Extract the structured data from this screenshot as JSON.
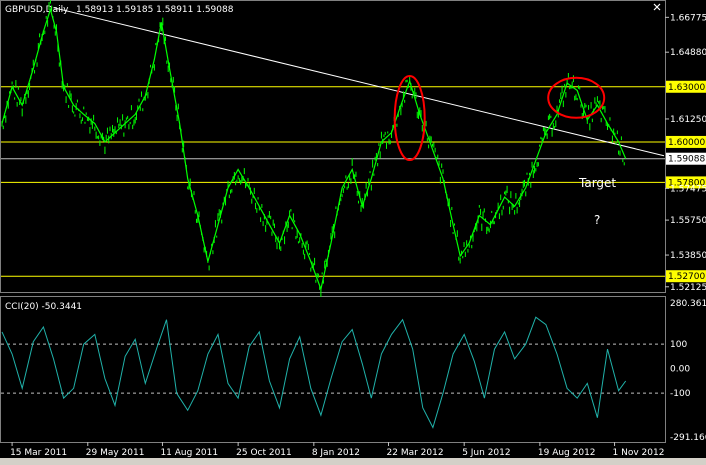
{
  "window": {
    "title": "GBPUSD,Daily",
    "ohlc": "1.58913 1.59185 1.58911 1.59088",
    "close_icon": "x-icon"
  },
  "colors": {
    "background": "#000000",
    "price": "#00ff00",
    "cci": "#20b2aa",
    "level": "#ffff00",
    "trend": "#ffffff",
    "highlight": "#ff0000",
    "current": "#ffffff"
  },
  "chart_data": [
    {
      "type": "line",
      "title": "GBPUSD,Daily",
      "ohlc_text": "1.58913 1.59185 1.58911 1.59088",
      "ylim": [
        1.5195,
        1.675
      ],
      "y_ticks": [
        "1.66775",
        "1.64880",
        "1.61250",
        "1.57475",
        "1.55750",
        "1.53850",
        "1.52125"
      ],
      "x_ticks": [
        "15 Mar 2011",
        "29 May 2011",
        "11 Aug 2011",
        "25 Oct 2011",
        "8 Jan 2012",
        "22 Mar 2012",
        "5 Jun 2012",
        "19 Aug 2012",
        "1 Nov 2012"
      ],
      "levels": [
        {
          "label": "1.63000",
          "value": 1.63
        },
        {
          "label": "1.60000",
          "value": 1.6
        },
        {
          "label": "1.59088",
          "value": 1.59088,
          "current": true
        },
        {
          "label": "1.57800",
          "value": 1.578
        },
        {
          "label": "1.52700",
          "value": 1.527
        }
      ],
      "trendline": {
        "from": {
          "x": "2011-04-25",
          "y": 1.673
        },
        "to": {
          "x": "2012-12-20",
          "y": 1.5925
        }
      },
      "annotations": [
        {
          "text": "Target"
        },
        {
          "text": "?"
        }
      ],
      "highlights": [
        {
          "x": "2012-04-12",
          "y": 1.613
        },
        {
          "x": "2012-09-24",
          "y": 1.624
        }
      ],
      "series": [
        {
          "x": [
            "2011-03-05",
            "2011-03-15",
            "2011-03-25",
            "2011-04-05",
            "2011-04-15",
            "2011-04-22",
            "2011-04-28",
            "2011-05-05",
            "2011-05-15",
            "2011-05-25",
            "2011-06-05",
            "2011-06-15",
            "2011-06-25",
            "2011-07-05",
            "2011-07-15",
            "2011-07-25",
            "2011-08-03",
            "2011-08-10",
            "2011-08-18",
            "2011-08-28",
            "2011-09-05",
            "2011-09-15",
            "2011-09-25",
            "2011-10-05",
            "2011-10-15",
            "2011-10-25",
            "2011-11-05",
            "2011-11-15",
            "2011-11-25",
            "2011-12-05",
            "2011-12-15",
            "2011-12-25",
            "2012-01-05",
            "2012-01-15",
            "2012-01-25",
            "2012-02-05",
            "2012-02-15",
            "2012-02-25",
            "2012-03-05",
            "2012-03-15",
            "2012-03-25",
            "2012-04-02",
            "2012-04-12",
            "2012-04-22",
            "2012-05-02",
            "2012-05-15",
            "2012-05-25",
            "2012-06-01",
            "2012-06-10",
            "2012-06-20",
            "2012-07-01",
            "2012-07-15",
            "2012-07-25",
            "2012-08-05",
            "2012-08-15",
            "2012-08-25",
            "2012-09-05",
            "2012-09-15",
            "2012-09-25",
            "2012-10-05",
            "2012-10-15",
            "2012-10-25",
            "2012-11-05",
            "2012-11-12"
          ],
          "y": [
            1.61,
            1.63,
            1.62,
            1.64,
            1.66,
            1.672,
            1.66,
            1.63,
            1.62,
            1.615,
            1.61,
            1.6,
            1.605,
            1.61,
            1.615,
            1.625,
            1.645,
            1.665,
            1.64,
            1.61,
            1.58,
            1.56,
            1.535,
            1.555,
            1.575,
            1.585,
            1.575,
            1.565,
            1.555,
            1.545,
            1.56,
            1.55,
            1.535,
            1.52,
            1.545,
            1.575,
            1.585,
            1.565,
            1.58,
            1.6,
            1.605,
            1.618,
            1.633,
            1.615,
            1.6,
            1.58,
            1.555,
            1.538,
            1.545,
            1.56,
            1.555,
            1.57,
            1.565,
            1.575,
            1.59,
            1.605,
            1.615,
            1.632,
            1.628,
            1.612,
            1.62,
            1.61,
            1.6,
            1.59088
          ]
        }
      ]
    },
    {
      "type": "line",
      "title": "CCI(20) -50.3441",
      "ylim": [
        -291.166,
        280.3617
      ],
      "y_ticks": [
        "280.3617",
        "100",
        "0.00",
        "-100",
        "-291.166"
      ],
      "levels": [
        100,
        -100
      ],
      "series": [
        {
          "x": [
            "2011-03-05",
            "2011-03-15",
            "2011-03-25",
            "2011-04-05",
            "2011-04-15",
            "2011-04-25",
            "2011-05-05",
            "2011-05-15",
            "2011-05-25",
            "2011-06-05",
            "2011-06-15",
            "2011-06-25",
            "2011-07-05",
            "2011-07-15",
            "2011-07-25",
            "2011-08-05",
            "2011-08-15",
            "2011-08-25",
            "2011-09-05",
            "2011-09-15",
            "2011-09-25",
            "2011-10-05",
            "2011-10-15",
            "2011-10-25",
            "2011-11-05",
            "2011-11-15",
            "2011-11-25",
            "2011-12-05",
            "2011-12-15",
            "2011-12-25",
            "2012-01-05",
            "2012-01-15",
            "2012-01-25",
            "2012-02-05",
            "2012-02-15",
            "2012-02-25",
            "2012-03-05",
            "2012-03-15",
            "2012-03-25",
            "2012-04-05",
            "2012-04-15",
            "2012-04-25",
            "2012-05-05",
            "2012-05-15",
            "2012-05-25",
            "2012-06-05",
            "2012-06-15",
            "2012-06-25",
            "2012-07-05",
            "2012-07-15",
            "2012-07-25",
            "2012-08-05",
            "2012-08-15",
            "2012-08-25",
            "2012-09-05",
            "2012-09-15",
            "2012-09-25",
            "2012-10-05",
            "2012-10-15",
            "2012-10-25",
            "2012-11-05",
            "2012-11-12"
          ],
          "y": [
            150,
            60,
            -80,
            110,
            170,
            40,
            -120,
            -80,
            100,
            140,
            -40,
            -150,
            50,
            120,
            -60,
            80,
            200,
            -100,
            -170,
            -90,
            60,
            140,
            -60,
            -120,
            90,
            150,
            -50,
            -160,
            40,
            130,
            -80,
            -190,
            -40,
            110,
            160,
            20,
            -120,
            60,
            140,
            200,
            80,
            -160,
            -240,
            -100,
            60,
            140,
            30,
            -120,
            80,
            150,
            40,
            100,
            210,
            180,
            60,
            -80,
            -120,
            -60,
            -200,
            80,
            -90,
            -50.3441
          ]
        }
      ]
    }
  ]
}
